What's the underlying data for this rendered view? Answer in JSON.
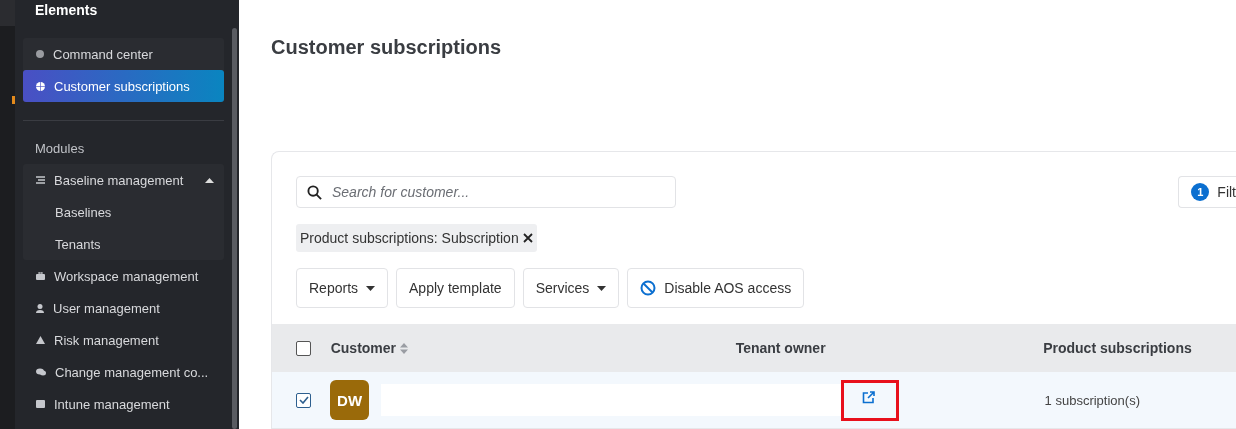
{
  "sidebar": {
    "title": "Elements",
    "items": [
      {
        "label": "Command center",
        "selected": false
      },
      {
        "label": "Customer subscriptions",
        "selected": true
      }
    ],
    "section": "Modules",
    "modules": [
      {
        "label": "Baseline management",
        "expanded": true,
        "children": [
          {
            "label": "Baselines"
          },
          {
            "label": "Tenants"
          }
        ]
      },
      {
        "label": "Workspace management"
      },
      {
        "label": "User management"
      },
      {
        "label": "Risk management"
      },
      {
        "label": "Change management co..."
      },
      {
        "label": "Intune management"
      }
    ]
  },
  "page": {
    "title": "Customer subscriptions"
  },
  "search": {
    "placeholder": "Search for customer..."
  },
  "filter_button": {
    "count": "1",
    "label": "Filt"
  },
  "chips": [
    {
      "label": "Product subscriptions: Subscription"
    }
  ],
  "actions": [
    {
      "label": "Reports",
      "kind": "dropdown"
    },
    {
      "label": "Apply template",
      "kind": "plain"
    },
    {
      "label": "Services",
      "kind": "dropdown"
    },
    {
      "label": "Disable AOS access",
      "kind": "blocked"
    }
  ],
  "table": {
    "columns": [
      "Customer",
      "Tenant owner",
      "Product subscriptions"
    ],
    "all_checked": false,
    "rows": [
      {
        "checked": true,
        "initials": "DW",
        "subscriptions": "1 subscription(s)"
      }
    ]
  }
}
